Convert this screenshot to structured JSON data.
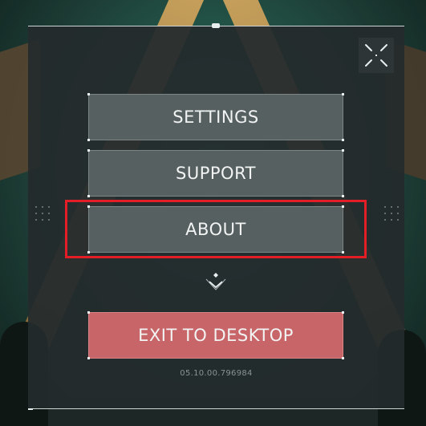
{
  "menu": {
    "settings_label": "SETTINGS",
    "support_label": "SUPPORT",
    "about_label": "ABOUT",
    "exit_label": "EXIT TO DESKTOP"
  },
  "footer": {
    "version": "05.10.00.796984"
  },
  "icons": {
    "expand": "fullscreen-icon",
    "more": "chevron-down-icon"
  },
  "colors": {
    "panel": "#242b2d",
    "button": "#576061",
    "exit_button": "#c86568",
    "highlight": "#e31e26"
  }
}
